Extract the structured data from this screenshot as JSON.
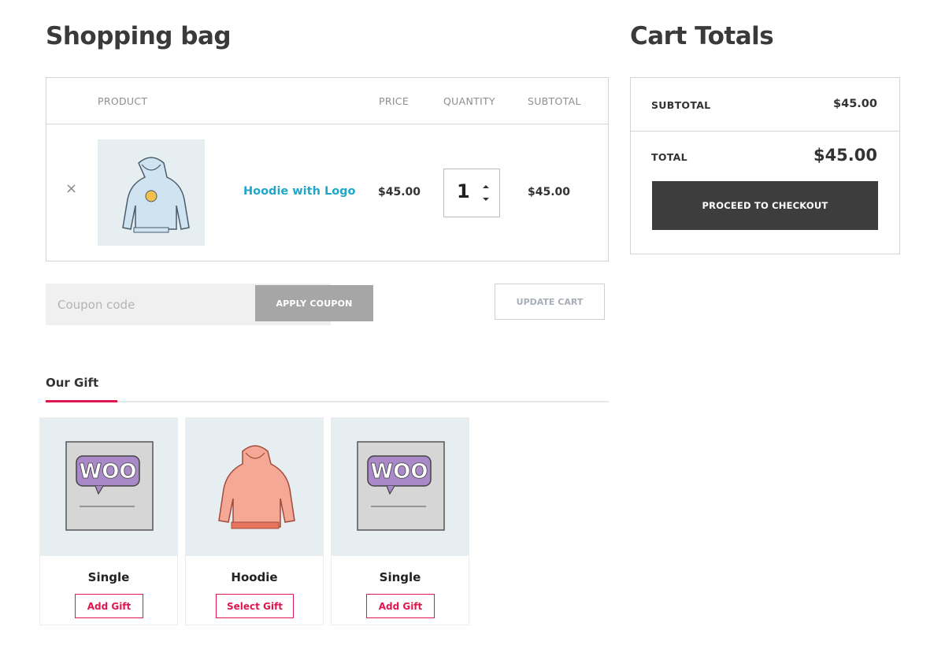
{
  "page": {
    "bag_title": "Shopping bag",
    "totals_title": "Cart Totals"
  },
  "cart": {
    "headers": {
      "product": "PRODUCT",
      "price": "PRICE",
      "quantity": "QUANTITY",
      "subtotal": "SUBTOTAL"
    },
    "items": [
      {
        "remove_glyph": "×",
        "name": "Hoodie with Logo",
        "price": "$45.00",
        "quantity": "1",
        "subtotal": "$45.00",
        "image_icon": "blue-hoodie-with-logo-image"
      }
    ]
  },
  "coupon": {
    "placeholder": "Coupon code",
    "value": "",
    "apply_label": "APPLY COUPON"
  },
  "update_cart_label": "UPDATE CART",
  "gift": {
    "title": "Our Gift",
    "items": [
      {
        "name": "Single",
        "button": "Add Gift",
        "image_icon": "woo-single-image"
      },
      {
        "name": "Hoodie",
        "button": "Select Gift",
        "image_icon": "pink-hoodie-image"
      },
      {
        "name": "Single",
        "button": "Add Gift",
        "image_icon": "woo-single-image"
      }
    ]
  },
  "totals": {
    "subtotal_label": "SUBTOTAL",
    "subtotal_value": "$45.00",
    "total_label": "TOTAL",
    "total_value": "$45.00",
    "checkout_label": "PROCEED TO CHECKOUT"
  },
  "colors": {
    "accent": "#e0174f",
    "link": "#1fa6c9",
    "checkout_bg": "#3d3d3d",
    "image_bg": "#e7eef2"
  }
}
